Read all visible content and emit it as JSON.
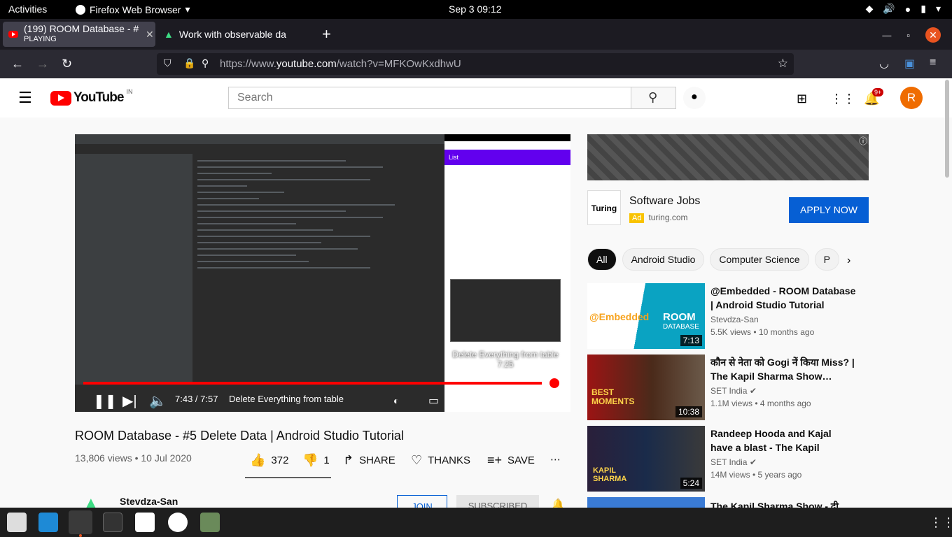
{
  "system_bar": {
    "activities": "Activities",
    "browser_label": "Firefox Web Browser",
    "clock": "Sep 3  09:12"
  },
  "tabs": [
    {
      "title": "(199) ROOM Database - #",
      "status": "PLAYING"
    },
    {
      "title": "Work with observable da"
    }
  ],
  "url": {
    "prefix": "https://www.",
    "domain": "youtube.com",
    "path": "/watch?v=MFKOwKxdhwU"
  },
  "youtube": {
    "logo_text": "YouTube",
    "region": "IN",
    "search_placeholder": "Search",
    "notification_count": "9+",
    "avatar_letter": "R"
  },
  "player": {
    "progress": 0.974,
    "emulator_title": "List",
    "preview_title": "Delete Everything from table",
    "preview_time": "7:25",
    "time_label": "7:43 / 7:57",
    "chapter": "Delete Everything from table"
  },
  "video": {
    "title": "ROOM Database - #5 Delete Data | Android Studio Tutorial",
    "meta": "13,806 views • 10 Jul 2020",
    "likes": "372",
    "dislikes": "1",
    "share": "SHARE",
    "thanks": "THANKS",
    "save": "SAVE",
    "channel": "Stevdza-San",
    "join": "JOIN",
    "subscribed": "SUBSCRIBED"
  },
  "ad": {
    "logo": "Turing",
    "title": "Software Jobs",
    "tag": "Ad",
    "domain": "turing.com",
    "cta": "APPLY NOW"
  },
  "chips": [
    "All",
    "Android Studio",
    "Computer Science",
    "P"
  ],
  "recommendations": [
    {
      "title": "@Embedded - ROOM Database | Android Studio Tutorial",
      "channel": "Stevdza-San",
      "meta": "5.5K views • 10 months ago",
      "duration": "7:13",
      "thumb_text": "@Embedded",
      "thumb_badge": "ROOM",
      "thumb_sub": "DATABASE"
    },
    {
      "title": "कौन से नेता को Gogi नें किया Miss? | The Kapil Sharma Show…",
      "channel": "SET India",
      "meta": "1.1M views • 4 months ago",
      "duration": "10:38",
      "thumb_text": "BEST MOMENTS"
    },
    {
      "title": "Randeep Hooda and Kajal have a blast - The Kapil Sharma…",
      "channel": "SET India",
      "meta": "14M views • 5 years ago",
      "duration": "5:24",
      "thumb_text": "KAPIL SHARMA"
    },
    {
      "title": "The Kapil Sharma Show - दी",
      "channel": "",
      "meta": "",
      "duration": ""
    }
  ]
}
